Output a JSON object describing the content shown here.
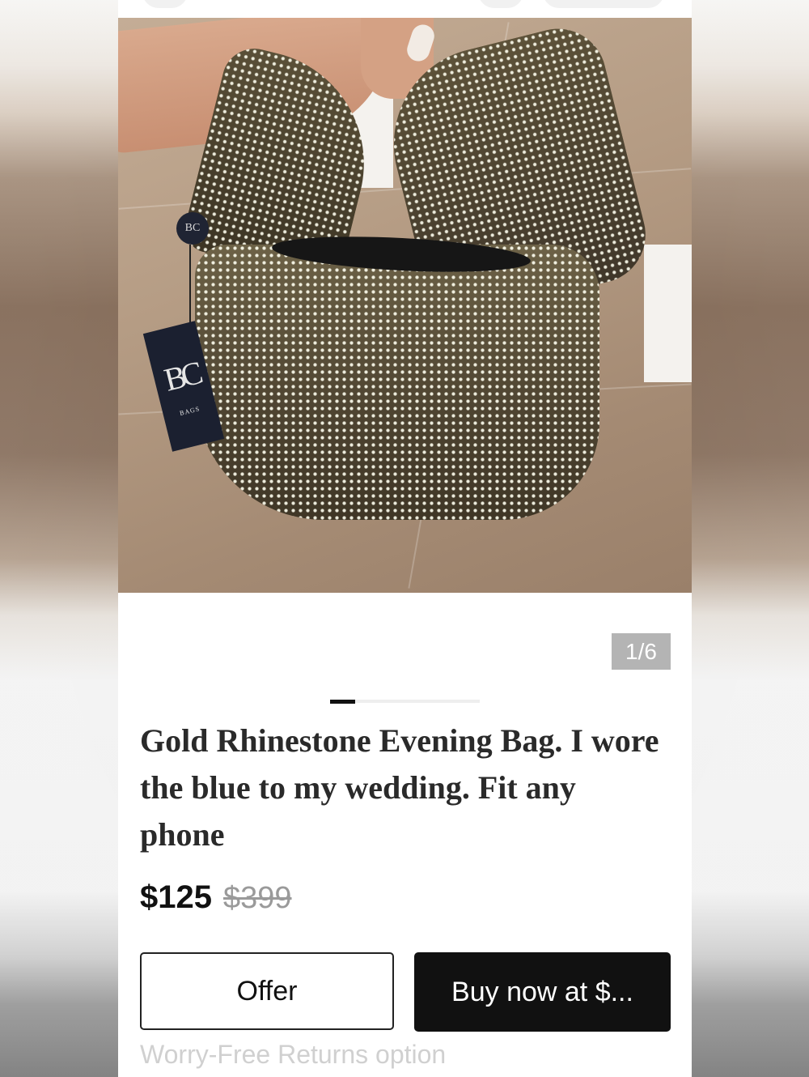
{
  "listing": {
    "image_counter": "1/6",
    "title": "Gold Rhinestone Evening Bag. I wore the blue to my wedding. Fit any phone",
    "price_current": "$125",
    "price_original": "$399",
    "tag_logo": "BC",
    "tag_sub": "BAGS"
  },
  "actions": {
    "offer_label": "Offer",
    "buy_label": "Buy now at $..."
  },
  "footer": {
    "returns_text": "Worry-Free Returns option"
  },
  "colors": {
    "buy_button": "#111111",
    "counter_badge": "#b4b4b4",
    "strikethrough_price": "#9a9a9a"
  }
}
